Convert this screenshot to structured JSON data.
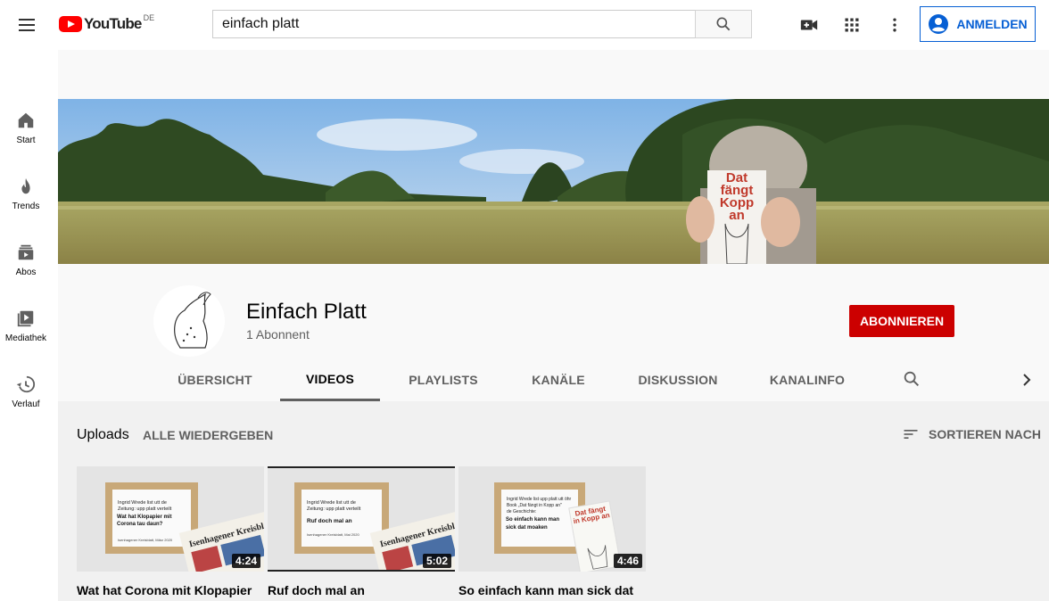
{
  "header": {
    "logo_word": "YouTube",
    "region": "DE",
    "search_value": "einfach platt",
    "signin_label": "ANMELDEN"
  },
  "sidebar": {
    "items": [
      {
        "label": "Start",
        "icon": "home-icon"
      },
      {
        "label": "Trends",
        "icon": "flame-icon"
      },
      {
        "label": "Abos",
        "icon": "subscriptions-icon"
      },
      {
        "label": "Mediathek",
        "icon": "library-icon"
      },
      {
        "label": "Verlauf",
        "icon": "history-icon"
      }
    ]
  },
  "banner": {
    "book_title_line1": "Dat",
    "book_title_line2": "fängt",
    "book_title_line3": "Kopp",
    "book_title_line4": "an"
  },
  "channel": {
    "name": "Einfach Platt",
    "subscribers": "1 Abonnent",
    "subscribe_label": "ABONNIEREN"
  },
  "tabs": [
    {
      "label": "ÜBERSICHT",
      "active": false
    },
    {
      "label": "VIDEOS",
      "active": true
    },
    {
      "label": "PLAYLISTS",
      "active": false
    },
    {
      "label": "KANÄLE",
      "active": false
    },
    {
      "label": "DISKUSSION",
      "active": false
    },
    {
      "label": "KANALINFO",
      "active": false
    }
  ],
  "uploads": {
    "title": "Uploads",
    "play_all": "ALLE WIEDERGEBEN",
    "sort_label": "SORTIEREN NACH"
  },
  "videos": [
    {
      "title": "Wat hat Corona mit Klopapier",
      "duration": "4:24",
      "card_line1": "Ingrid Wrede list utt de",
      "card_line2": "Zeitung: upp platt verteilt",
      "card_headline": "Wat hat Klopapier mit Corona tau daun?",
      "card_source": "Isenhagener Kreisblatt, März 2020",
      "paper_name": "Isenhagener Kreisblatt"
    },
    {
      "title": "Ruf doch mal an",
      "duration": "5:02",
      "card_line1": "Ingrid Wrede list utt de",
      "card_line2": "Zeitung: upp platt verteilt",
      "card_headline": "Ruf doch mal an",
      "card_source": "Isenhagener Kreisblatt, Mai 2020",
      "paper_name": "Isenhagener Kreisblatt"
    },
    {
      "title": "So einfach kann man sick dat",
      "duration": "4:46",
      "card_line1": "Ingrid Wrede list upp platt utt öhr",
      "card_line2": "Book „Dat fängt in Kopp an\"",
      "card_line3": "de Geschichte:",
      "card_headline": "So einfach kann man sick dat moaken",
      "book_title": "Dat fängt in Kopp an"
    }
  ],
  "colors": {
    "brand_red": "#ff0000",
    "subscribe_red": "#cc0000",
    "link_blue": "#065fd4"
  }
}
